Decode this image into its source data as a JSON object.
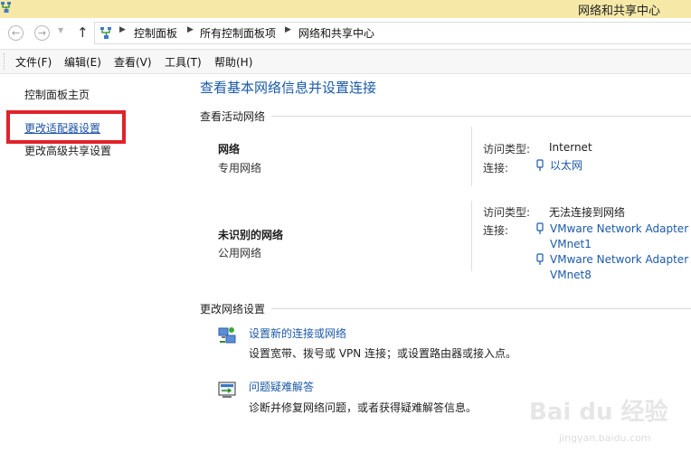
{
  "window": {
    "title": "网络和共享中心"
  },
  "address": {
    "back_glyph": "←",
    "forward_glyph": "→",
    "recent_glyph": "▼",
    "up_glyph": "↑",
    "separator": "▶",
    "crumbs": [
      "控制面板",
      "所有控制面板项",
      "网络和共享中心"
    ]
  },
  "menu": {
    "items": [
      "文件(F)",
      "编辑(E)",
      "查看(V)",
      "工具(T)",
      "帮助(H)"
    ]
  },
  "sidebar": {
    "home": "控制面板主页",
    "adapter_settings": "更改适配器设置",
    "advanced_sharing": "更改高级共享设置"
  },
  "main": {
    "title": "查看基本网络信息并设置连接",
    "active_networks": {
      "heading": "查看活动网络",
      "networks": [
        {
          "name": "网络",
          "type": "专用网络",
          "access_label": "访问类型:",
          "access_value": "Internet",
          "connection_label": "连接:",
          "connections": [
            "以太网"
          ]
        },
        {
          "name": "未识别的网络",
          "type": "公用网络",
          "access_label": "访问类型:",
          "access_value": "无法连接到网络",
          "connection_label": "连接:",
          "connections": [
            "VMware Network Adapter\nVMnet1",
            "VMware Network Adapter\nVMnet8"
          ]
        }
      ]
    },
    "change_settings": {
      "heading": "更改网络设置",
      "tasks": [
        {
          "label": "设置新的连接或网络",
          "description": "设置宽带、拨号或 VPN 连接；或设置路由器或接入点。",
          "icon": "network-setup-icon"
        },
        {
          "label": "问题疑难解答",
          "description": "诊断并修复网络问题，或者获得疑难解答信息。",
          "icon": "troubleshoot-icon"
        }
      ]
    }
  },
  "watermark": {
    "logo": "Bai du 经验",
    "url": "jingyan.baidu.com"
  },
  "colors": {
    "titlebar": "#f6e9a8",
    "link": "#1c5aa8",
    "heading_blue": "#1a5aa8",
    "highlight_red": "#e0222a"
  }
}
